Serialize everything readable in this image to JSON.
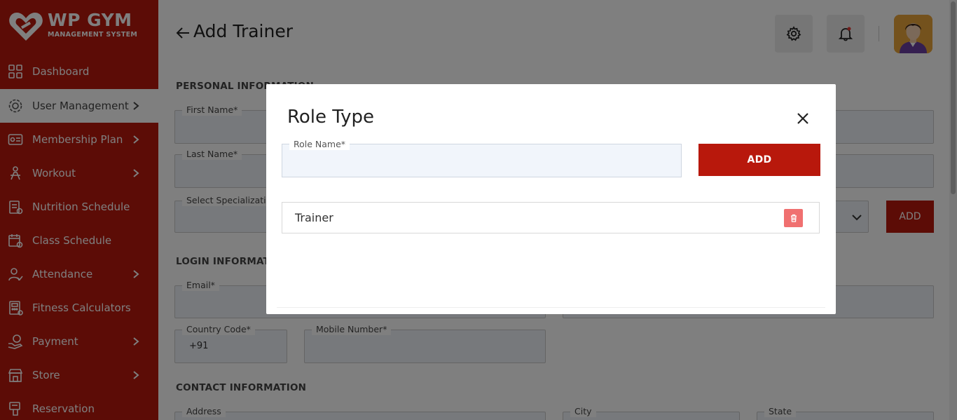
{
  "app": {
    "logo_title": "WP GYM",
    "logo_subtitle": "MANAGEMENT SYSTEM",
    "accent_color": "#b8180c"
  },
  "sidebar": {
    "items": [
      {
        "label": "Dashboard",
        "icon": "grid-icon",
        "has_chevron": false,
        "active": false
      },
      {
        "label": "User Management",
        "icon": "users-gear-icon",
        "has_chevron": true,
        "active": true
      },
      {
        "label": "Membership Plan",
        "icon": "membership-card-icon",
        "has_chevron": true,
        "active": false
      },
      {
        "label": "Workout",
        "icon": "workout-icon",
        "has_chevron": true,
        "active": false
      },
      {
        "label": "Nutrition Schedule",
        "icon": "nutrition-icon",
        "has_chevron": false,
        "active": false
      },
      {
        "label": "Class Schedule",
        "icon": "calendar-icon",
        "has_chevron": false,
        "active": false
      },
      {
        "label": "Attendance",
        "icon": "attendance-icon",
        "has_chevron": true,
        "active": false
      },
      {
        "label": "Fitness Calculators",
        "icon": "calculator-icon",
        "has_chevron": false,
        "active": false
      },
      {
        "label": "Payment",
        "icon": "payment-icon",
        "has_chevron": true,
        "active": false
      },
      {
        "label": "Store",
        "icon": "store-icon",
        "has_chevron": true,
        "active": false
      },
      {
        "label": "Reservation",
        "icon": "reservation-icon",
        "has_chevron": false,
        "active": false
      }
    ]
  },
  "header": {
    "title": "Add Trainer"
  },
  "form": {
    "personal_section": "PERSONAL INFORMATION",
    "first_name_label": "First Name*",
    "last_name_label": "Last Name*",
    "specialization_label": "Select Specialization",
    "specialization_add": "ADD",
    "login_section": "LOGIN INFORMATION",
    "email_label": "Email*",
    "country_code_label": "Country Code*",
    "country_code_value": "+91",
    "mobile_label": "Mobile Number*",
    "contact_section": "CONTACT INFORMATION",
    "address_label": "Address",
    "city_label": "City",
    "state_label": "State"
  },
  "modal": {
    "title": "Role Type",
    "role_name_label": "Role Name*",
    "role_name_value": "",
    "add_label": "ADD",
    "roles": [
      {
        "name": "Trainer"
      }
    ]
  }
}
